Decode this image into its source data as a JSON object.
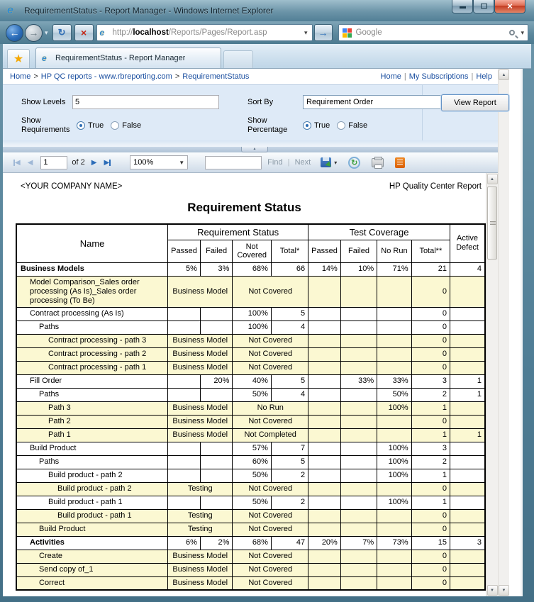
{
  "window": {
    "title": "RequirementStatus - Report Manager - Windows Internet Explorer"
  },
  "nav": {
    "url_prefix": "http://",
    "url_host": "localhost",
    "url_path": "/Reports/Pages/Report.asp",
    "search_placeholder": "Google"
  },
  "tabs": {
    "active": "RequirementStatus - Report Manager"
  },
  "breadcrumb": {
    "items": [
      "Home",
      "HP QC reports - www.rbreporting.com",
      "RequirementStatus"
    ],
    "links": [
      "Home",
      "My Subscriptions",
      "Help"
    ]
  },
  "params": {
    "show_levels_label": "Show Levels",
    "show_levels_value": "5",
    "sort_by_label": "Sort By",
    "sort_by_value": "Requirement Order",
    "show_requirements_label_1": "Show",
    "show_requirements_label_2": "Requirements",
    "show_percentage_label_1": "Show",
    "show_percentage_label_2": "Percentage",
    "radio_true": "True",
    "radio_false": "False",
    "view_report": "View Report"
  },
  "toolbar": {
    "page_value": "1",
    "of_label": "of 2",
    "zoom_value": "100%",
    "find_label": "Find",
    "next_label": "Next"
  },
  "report": {
    "company": "<YOUR COMPANY NAME>",
    "header_right": "HP Quality Center Report",
    "title": "Requirement Status"
  },
  "table": {
    "headers": {
      "name": "Name",
      "group1": "Requirement Status",
      "group2": "Test Coverage",
      "active_defect": "Active Defect",
      "sub": [
        "Passed",
        "Failed",
        "Not Covered",
        "Total*",
        "Passed",
        "Failed",
        "No Run",
        "Total**"
      ]
    },
    "rows": [
      {
        "name": "Business Models",
        "indent": 0,
        "bold": true,
        "bg": "white",
        "kind": "plain",
        "passed": "5%",
        "failed": "3%",
        "not_covered": "68%",
        "total": "66",
        "tc_passed": "14%",
        "tc_failed": "10%",
        "no_run": "71%",
        "total2": "21",
        "defect": "4"
      },
      {
        "name": "Model Comparison_Sales order processing (As Is)_Sales order processing (To Be)",
        "indent": 1,
        "bg": "yellow",
        "kind": "merged",
        "req_type": "Business Model",
        "coverage": "Not Covered",
        "total2": "0"
      },
      {
        "name": "Contract processing (As Is)",
        "indent": 1,
        "bg": "white",
        "kind": "plain",
        "not_covered": "100%",
        "total": "5",
        "total2": "0"
      },
      {
        "name": "Paths",
        "indent": 2,
        "bg": "white",
        "kind": "plain",
        "not_covered": "100%",
        "total": "4",
        "total2": "0"
      },
      {
        "name": "Contract processing - path 3",
        "indent": 3,
        "bg": "yellow",
        "kind": "merged",
        "req_type": "Business Model",
        "coverage": "Not Covered",
        "total2": "0"
      },
      {
        "name": "Contract processing - path 2",
        "indent": 3,
        "bg": "yellow",
        "kind": "merged",
        "req_type": "Business Model",
        "coverage": "Not Covered",
        "total2": "0"
      },
      {
        "name": "Contract processing - path 1",
        "indent": 3,
        "bg": "yellow",
        "kind": "merged",
        "req_type": "Business Model",
        "coverage": "Not Covered",
        "total2": "0"
      },
      {
        "name": "Fill Order",
        "indent": 1,
        "bg": "white",
        "kind": "plain",
        "failed": "20%",
        "not_covered": "40%",
        "total": "5",
        "tc_failed": "33%",
        "no_run": "33%",
        "total2": "3",
        "defect": "1"
      },
      {
        "name": "Paths",
        "indent": 2,
        "bg": "white",
        "kind": "plain",
        "not_covered": "50%",
        "total": "4",
        "no_run": "50%",
        "total2": "2",
        "defect": "1"
      },
      {
        "name": "Path 3",
        "indent": 3,
        "bg": "yellow",
        "kind": "merged",
        "req_type": "Business Model",
        "coverage": "No Run",
        "no_run": "100%",
        "total2": "1"
      },
      {
        "name": "Path 2",
        "indent": 3,
        "bg": "yellow",
        "kind": "merged",
        "req_type": "Business Model",
        "coverage": "Not Covered",
        "total2": "0"
      },
      {
        "name": "Path 1",
        "indent": 3,
        "bg": "yellow",
        "kind": "merged",
        "req_type": "Business Model",
        "coverage": "Not Completed",
        "total2": "1",
        "defect": "1"
      },
      {
        "name": "Build Product",
        "indent": 1,
        "bg": "white",
        "kind": "plain",
        "not_covered": "57%",
        "total": "7",
        "no_run": "100%",
        "total2": "3"
      },
      {
        "name": "Paths",
        "indent": 2,
        "bg": "white",
        "kind": "plain",
        "not_covered": "60%",
        "total": "5",
        "no_run": "100%",
        "total2": "2"
      },
      {
        "name": "Build product - path 2",
        "indent": 3,
        "bg": "white",
        "kind": "plain",
        "not_covered": "50%",
        "total": "2",
        "no_run": "100%",
        "total2": "1"
      },
      {
        "name": "Build product - path 2",
        "indent": 4,
        "bg": "yellow",
        "kind": "merged",
        "req_type": "Testing",
        "coverage": "Not Covered",
        "total2": "0"
      },
      {
        "name": "Build product - path 1",
        "indent": 3,
        "bg": "white",
        "kind": "plain",
        "not_covered": "50%",
        "total": "2",
        "no_run": "100%",
        "total2": "1"
      },
      {
        "name": "Build product - path 1",
        "indent": 4,
        "bg": "yellow",
        "kind": "merged",
        "req_type": "Testing",
        "coverage": "Not Covered",
        "total2": "0"
      },
      {
        "name": "Build Product",
        "indent": 2,
        "bg": "yellow",
        "kind": "merged",
        "req_type": "Testing",
        "coverage": "Not Covered",
        "total2": "0"
      },
      {
        "name": "Activities",
        "indent": 1,
        "bold": true,
        "bg": "white",
        "kind": "plain",
        "passed": "6%",
        "failed": "2%",
        "not_covered": "68%",
        "total": "47",
        "tc_passed": "20%",
        "tc_failed": "7%",
        "no_run": "73%",
        "total2": "15",
        "defect": "3"
      },
      {
        "name": "Create",
        "indent": 2,
        "bg": "yellow",
        "kind": "merged",
        "req_type": "Business Model",
        "coverage": "Not Covered",
        "total2": "0"
      },
      {
        "name": "Send copy of_1",
        "indent": 2,
        "bg": "yellow",
        "kind": "merged",
        "req_type": "Business Model",
        "coverage": "Not Covered",
        "total2": "0"
      },
      {
        "name": "Correct",
        "indent": 2,
        "bg": "yellow",
        "kind": "merged",
        "req_type": "Business Model",
        "coverage": "Not Covered",
        "total2": "0"
      }
    ]
  },
  "icons": {
    "back": "←",
    "forward": "→",
    "chevron_down": "▾",
    "refresh": "↻",
    "stop": "×",
    "go": "→",
    "star": "★",
    "splitter_up": "▲",
    "prev": "◀",
    "next": "▶",
    "caret": "▾",
    "sep_gt": ">",
    "sep_pipe": "|",
    "up": "▲",
    "down": "▼",
    "refresh_report": "↻",
    "close": "×"
  },
  "colors": {
    "frame_teal": "#4F7D95",
    "row_yellow": "#FBF8D2",
    "link_blue": "#1B4FA0",
    "params_blue": "#DEEAF7",
    "close_red": "#C23A20"
  }
}
